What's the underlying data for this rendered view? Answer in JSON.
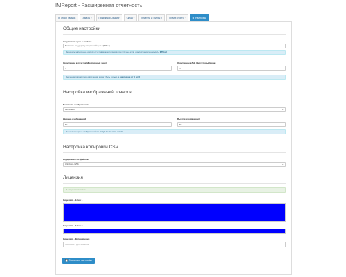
{
  "header": {
    "title": "IMReport - Расширенная отчетность"
  },
  "tabs": [
    {
      "label": "Обзор заказов",
      "icon": "chart-icon",
      "caret": false
    },
    {
      "label": "Заказы",
      "caret": true
    },
    {
      "label": "Продукты и Опции",
      "caret": true
    },
    {
      "label": "Склад",
      "caret": true
    },
    {
      "label": "Клиенты и Группы",
      "caret": true
    },
    {
      "label": "Прочие отчеты",
      "caret": true
    },
    {
      "label": "Настройки",
      "icon": "gear-icon",
      "caret": false,
      "active": true
    }
  ],
  "general": {
    "title": "Общие настройки",
    "purchase_label": "Закупочная цена в отчётах",
    "purchase_value": "Включить поддержку закупочной цены (Mfilter)",
    "purchase_info_text": "Включить закупочную допуск отчётов можно только в том случае, если у вас установлен модуль ",
    "purchase_info_bold": "IMStock",
    "qty_report_label": "Округление в отчётах (Десятичный знак)",
    "qty_report_value": "2",
    "qty_db_label": "Округление в БД (Десятичный знак)",
    "qty_db_value": "4",
    "round_info_text": "Значение параметров округления может быть только ",
    "round_info_bold": "в диапазоне от 0 до 6"
  },
  "images": {
    "title": "Настройка изображений товаров",
    "enable_label": "Включить изображения",
    "enable_value": "Включено",
    "width_label": "Ширина изображений",
    "width_value": "50",
    "height_label": "Высота изображений",
    "height_value": "50",
    "info_text": "Высота и ширина изображений ",
    "info_bold": "не могут быть меньше 10"
  },
  "csv": {
    "title": "Настройка кодировки CSV",
    "encoding_label": "Кодировка CSV файлов",
    "encoding_value": "Windows-1251"
  },
  "license": {
    "title": "Лицензия",
    "success_text": "Лицензия активна",
    "key1_label": "Лицензия - Ключ 1",
    "key2_label": "Лицензия - Ключ 2",
    "extra_label": "Лицензия - Доп.значение",
    "extra_placeholder": "Лицензия - Доп.значение",
    "key_fill_color": "#0000ff"
  },
  "actions": {
    "save_label": "Сохранить настройки"
  }
}
